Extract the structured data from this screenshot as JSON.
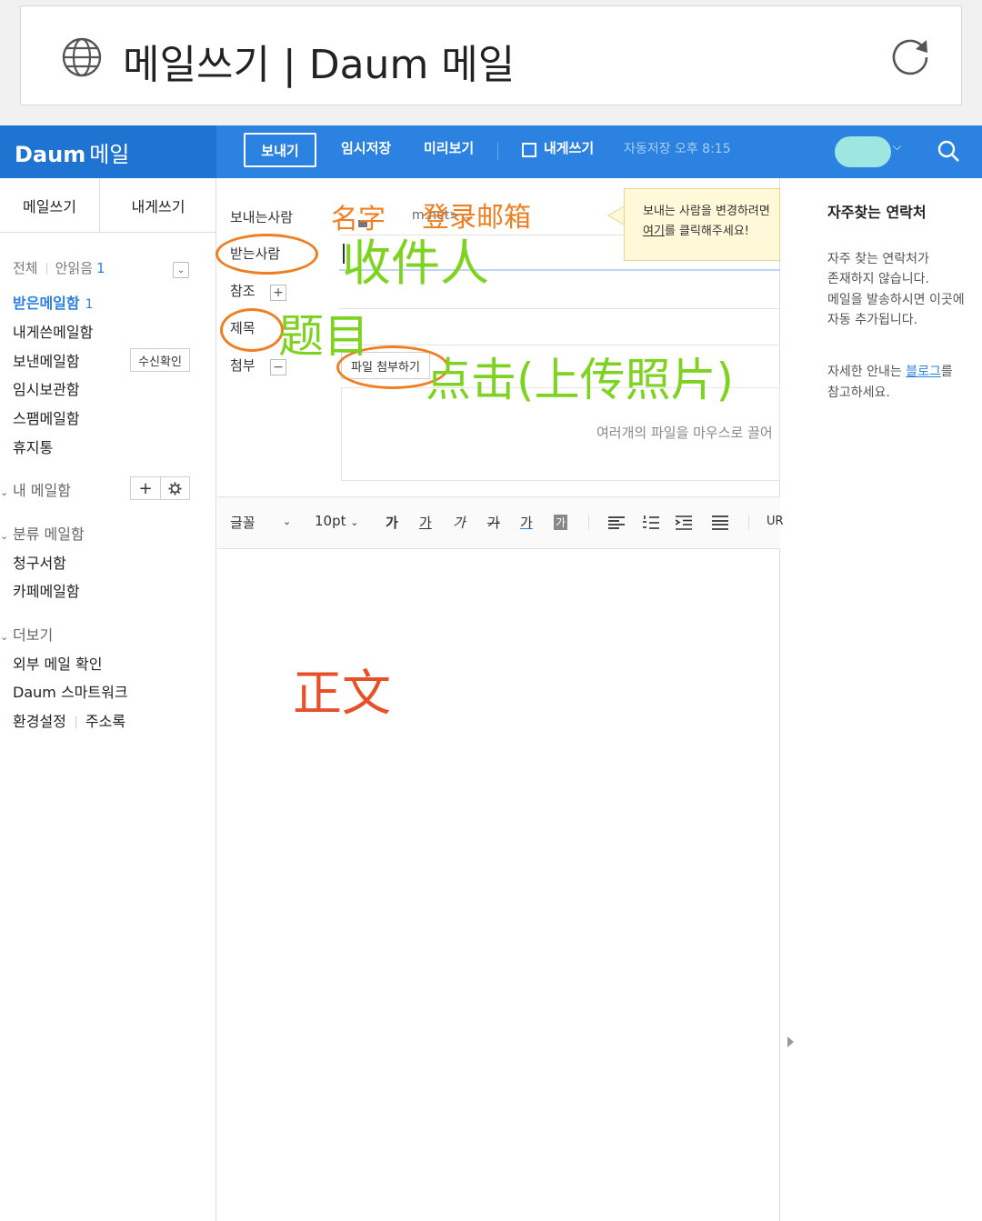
{
  "browser": {
    "title": "메일쓰기 | Daum 메일"
  },
  "header": {
    "logo_brand": "Daum",
    "logo_product": "메일",
    "send_label": "보내기",
    "draft_label": "임시저장",
    "preview_label": "미리보기",
    "self_write_label": "내게쓰기",
    "autosave_text": "자동저장 오후 8:15",
    "accent_color": "#2b82e0"
  },
  "sidebar": {
    "tabs": [
      "메일쓰기",
      "내게쓰기"
    ],
    "filter_all": "전체",
    "filter_unread": "안읽음",
    "filter_unread_count": "1",
    "inbox_label": "받은메일함",
    "inbox_count": "1",
    "items": [
      "내게쓴메일함",
      "보낸메일함",
      "임시보관함",
      "스팸메일함",
      "휴지통"
    ],
    "receipt_check_label": "수신확인",
    "my_mailbox_label": "내 메일함",
    "category_label": "분류 메일함",
    "category_items": [
      "청구서함",
      "카페메일함"
    ],
    "more_label": "더보기",
    "more_items": [
      "외부 메일 확인",
      "Daum 스마트워크"
    ],
    "settings_label": "환경설정",
    "addressbook_label": "주소록"
  },
  "compose": {
    "from_label": "보내는사람",
    "from_value": "m.net>",
    "to_label": "받는사람",
    "cc_label": "참조",
    "subject_label": "제목",
    "attach_label": "첨부",
    "attach_button": "파일 첨부하기",
    "drop_hint": "여러개의 파일을 마우스로 끌어",
    "tooltip_line1": "보내는 사람을 변경하려면",
    "tooltip_link": "여기",
    "tooltip_line2": "를 클릭해주세요!"
  },
  "editor_toolbar": {
    "font_label": "글꼴",
    "size_label": "10pt",
    "bold_icon": "가",
    "underline_icon": "가",
    "italic_icon": "가",
    "strike_icon": "가",
    "color_icon": "가",
    "bg_icon": "가",
    "url_label": "UR"
  },
  "right_panel": {
    "title": "자주찾는 연락처",
    "desc_lines": [
      "자주 찾는 연락처가",
      "존재하지 않습니다.",
      "메일을 발송하시면 이곳에",
      "자동 추가됩니다."
    ],
    "help_prefix": "자세한 안내는 ",
    "help_link": "블로그",
    "help_suffix": "를",
    "help_line2": "참고하세요."
  },
  "annotations": {
    "name": "名字",
    "login_email": "登录邮箱",
    "recipient": "收件人",
    "subject": "题目",
    "click_upload": "点击(上传照片)",
    "body": "正文",
    "orange_color": "#ef7f22",
    "green_color": "#7ed321",
    "red_color": "#e8502a"
  }
}
